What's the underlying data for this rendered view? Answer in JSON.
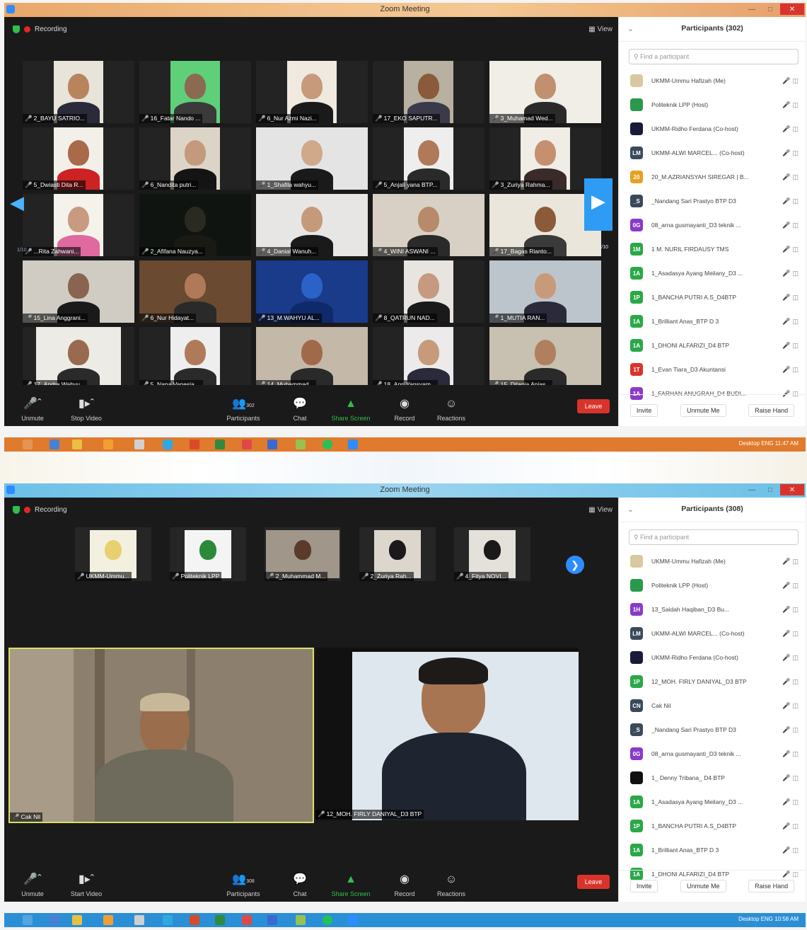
{
  "window_title": "Zoom Meeting",
  "recording_label": "Recording",
  "view_label": "View",
  "top": {
    "page_indicator": "1/10",
    "page_indicator_right": "1/10",
    "participants_title": "Participants (302)",
    "search_placeholder": "Find a participant",
    "tiles": [
      "2_BAYU SATRIO...",
      "16_Fatar Nando ...",
      "6_Nur Azmi Nazi...",
      "17_EKO SAPUTR...",
      "3_Muhamad Wed...",
      "5_Dwiasti Dita R...",
      "6_Nandita putri...",
      "1_Shafila wahyu...",
      "5_Anjali yana BTP...",
      "3_Zuriya Rahma...",
      "...Rita Zahwani...",
      "2_Afifana Nauzya...",
      "4_Danial Wanuh...",
      "4_WINI ASWANI ...",
      "17_Bagas Rianto...",
      "15_Lina Anggrani...",
      "6_Nur Hidayat...",
      "13_M.WAHYU AL...",
      "8_QATRUN NAD...",
      "1_MUTIA RAN...",
      "17_Andre Wahyu...",
      "5_Nana Vanesia ...",
      "14_Muhammad...",
      "18_Apri Yansyam...",
      "15_Ditapia Anjas..."
    ],
    "participants": [
      {
        "initials": "",
        "name": "UKMM-Ummu Hafizah (Me)",
        "color": "#d9c9a0"
      },
      {
        "initials": "",
        "name": "Politeknik LPP (Host)",
        "color": "#2a9a4a"
      },
      {
        "initials": "",
        "name": "UKMM-Ridho Ferdana (Co-host)",
        "color": "#1a1a3a"
      },
      {
        "initials": "LM",
        "name": "UKMM-ALWI MARCEL... (Co-host)",
        "color": "#3a4a5a"
      },
      {
        "initials": "20",
        "name": "20_M.AZRIANSYAH SIREGAR | B...",
        "color": "#e8a020"
      },
      {
        "initials": "_S",
        "name": "_Nandang Sari Prastyo BTP D3",
        "color": "#3a4a5a"
      },
      {
        "initials": "0G",
        "name": "08_arna gusmayanti_D3 teknik ...",
        "color": "#8a3ac8"
      },
      {
        "initials": "1M",
        "name": "1 M. NURIL FIRDAUSY TMS",
        "color": "#2aa848"
      },
      {
        "initials": "1A",
        "name": "1_Asadasya Ayang Meilany_D3 ...",
        "color": "#2aa848"
      },
      {
        "initials": "1P",
        "name": "1_BANCHA PUTRI A.S_D4BTP",
        "color": "#2aa848"
      },
      {
        "initials": "1A",
        "name": "1_Brilliant Anas_BTP D 3",
        "color": "#2aa848"
      },
      {
        "initials": "1A",
        "name": "1_DHONI ALFARIZI_D4 BTP",
        "color": "#2aa848"
      },
      {
        "initials": "1T",
        "name": "1_Evan Tiara_D3 Akuntansi",
        "color": "#d9342b"
      },
      {
        "initials": "1A",
        "name": "1_FARHAN ANUGRAH_D4 BUDI...",
        "color": "#8a3ac8"
      }
    ],
    "tray_text": "Desktop  ENG  11:47 AM"
  },
  "bottom": {
    "participants_title": "Participants (308)",
    "search_placeholder": "Find a participant",
    "strip": [
      "UKMM-Ummu...",
      "Politeknik LPP",
      "2_Muhammad M...",
      "2_Zuriya Rah...",
      "4_Fitya NOVI..."
    ],
    "big_left_name": "Cak Nil",
    "big_right_name": "12_MOH. FIRLY DANIYAL_D3 BTP",
    "participants": [
      {
        "initials": "",
        "name": "UKMM-Ummu Hafizah (Me)",
        "color": "#d9c9a0"
      },
      {
        "initials": "",
        "name": "Politeknik LPP (Host)",
        "color": "#2a9a4a"
      },
      {
        "initials": "1H",
        "name": "13_Saidah Haqiban_D3 Bu...",
        "color": "#8a3ac8"
      },
      {
        "initials": "LM",
        "name": "UKMM-ALWI MARCEL... (Co-host)",
        "color": "#3a4a5a"
      },
      {
        "initials": "",
        "name": "UKMM-Ridho Ferdana (Co-host)",
        "color": "#1a1a3a"
      },
      {
        "initials": "1P",
        "name": "12_MOH. FIRLY DANIYAL_D3 BTP",
        "color": "#2aa848"
      },
      {
        "initials": "CN",
        "name": "Cak Nil",
        "color": "#3a4a5a"
      },
      {
        "initials": "_S",
        "name": "_Nandang Sari Prastyo BTP D3",
        "color": "#3a4a5a"
      },
      {
        "initials": "0G",
        "name": "08_arna gusmayanti_D3 teknik ...",
        "color": "#8a3ac8"
      },
      {
        "initials": "",
        "name": "1_ Denny Tribana_ D4 BTP",
        "color": "#111111"
      },
      {
        "initials": "1A",
        "name": "1_Asadasya Ayang Meilany_D3 ...",
        "color": "#2aa848"
      },
      {
        "initials": "1P",
        "name": "1_BANCHA PUTRI A.S_D4BTP",
        "color": "#2aa848"
      },
      {
        "initials": "1A",
        "name": "1_Brilliant Anas_BTP D 3",
        "color": "#2aa848"
      },
      {
        "initials": "1A",
        "name": "1_DHONI ALFARIZI_D4 BTP",
        "color": "#2aa848"
      }
    ],
    "tray_text": "Desktop  ENG  10:58 AM"
  },
  "toolbar": {
    "unmute": "Unmute",
    "stop_video": "Stop Video",
    "start_video": "Start Video",
    "participants": "Participants",
    "participants_count_top": "302",
    "participants_count_bottom": "308",
    "chat": "Chat",
    "share_screen": "Share Screen",
    "record": "Record",
    "reactions": "Reactions",
    "leave": "Leave"
  },
  "panel_buttons": {
    "invite": "Invite",
    "unmute_me": "Unmute Me",
    "raise_hand": "Raise Hand"
  }
}
